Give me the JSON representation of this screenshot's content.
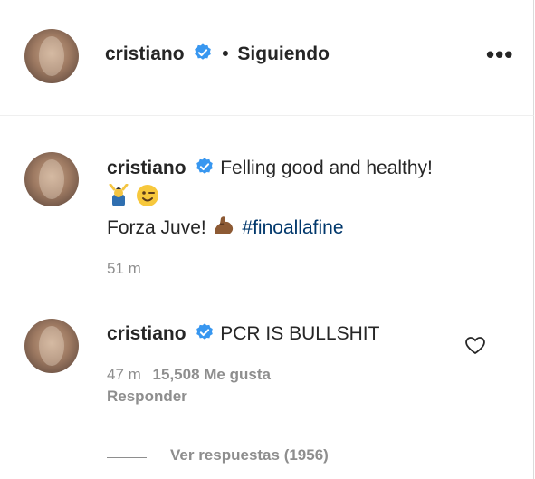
{
  "header": {
    "username": "cristiano",
    "separator": "•",
    "follow_status": "Siguiendo",
    "more_label": "•••"
  },
  "caption": {
    "username": "cristiano",
    "text_line1": "Felling good and healthy!",
    "emojis": [
      "person-raising-hands-emoji",
      "winking-face-emoji"
    ],
    "text_line3_prefix": "Forza Juve!",
    "line3_emoji": "flexed-biceps-emoji",
    "hashtag": "#finoallafine",
    "time": "51 m"
  },
  "comment": {
    "username": "cristiano",
    "text": "PCR IS BULLSHIT",
    "time": "47 m",
    "likes": "15,508 Me gusta",
    "reply_label": "Responder",
    "view_replies": "Ver respuestas (1956)"
  },
  "colors": {
    "verified": "#3897f0",
    "text": "#262626",
    "secondary": "#8e8e8e",
    "hashtag": "#00376b"
  }
}
